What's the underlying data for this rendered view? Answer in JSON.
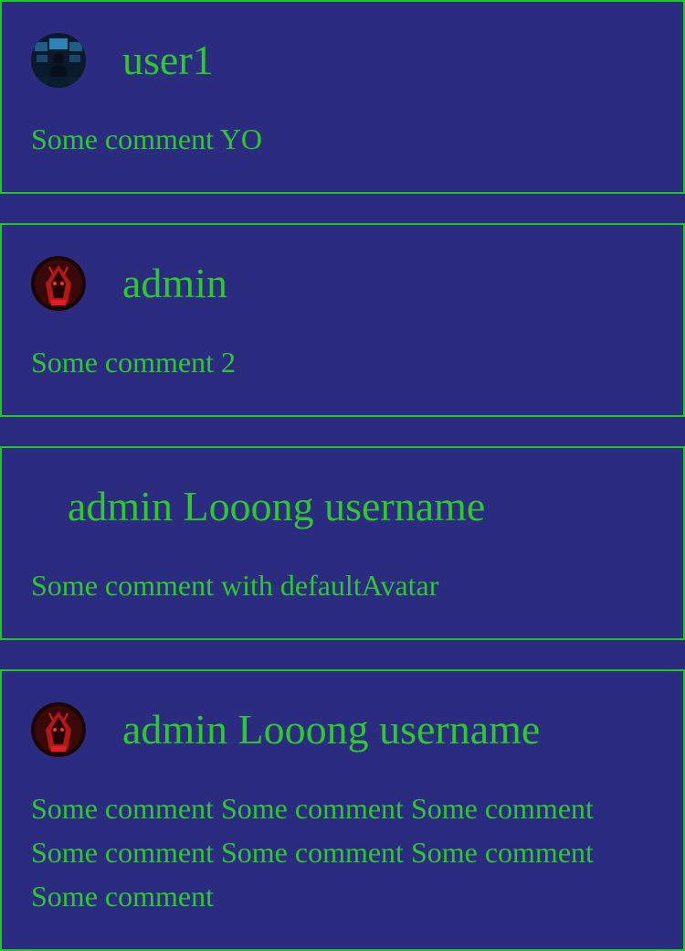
{
  "comments": [
    {
      "username": "user1",
      "avatar": "hacker-avatar-icon",
      "text": "Some comment YO"
    },
    {
      "username": "admin",
      "avatar": "red-hooded-avatar-icon",
      "text": "Some comment 2"
    },
    {
      "username": "admin Looong username",
      "avatar": "default-avatar",
      "text": "Some comment with defaultAvatar"
    },
    {
      "username": "admin Looong username",
      "avatar": "red-hooded-avatar-icon",
      "text": "Some comment Some comment Some comment Some comment Some comment Some comment Some comment"
    }
  ],
  "colors": {
    "background": "#2b2b80",
    "border": "#1ec81e",
    "text": "#2ec82e"
  }
}
